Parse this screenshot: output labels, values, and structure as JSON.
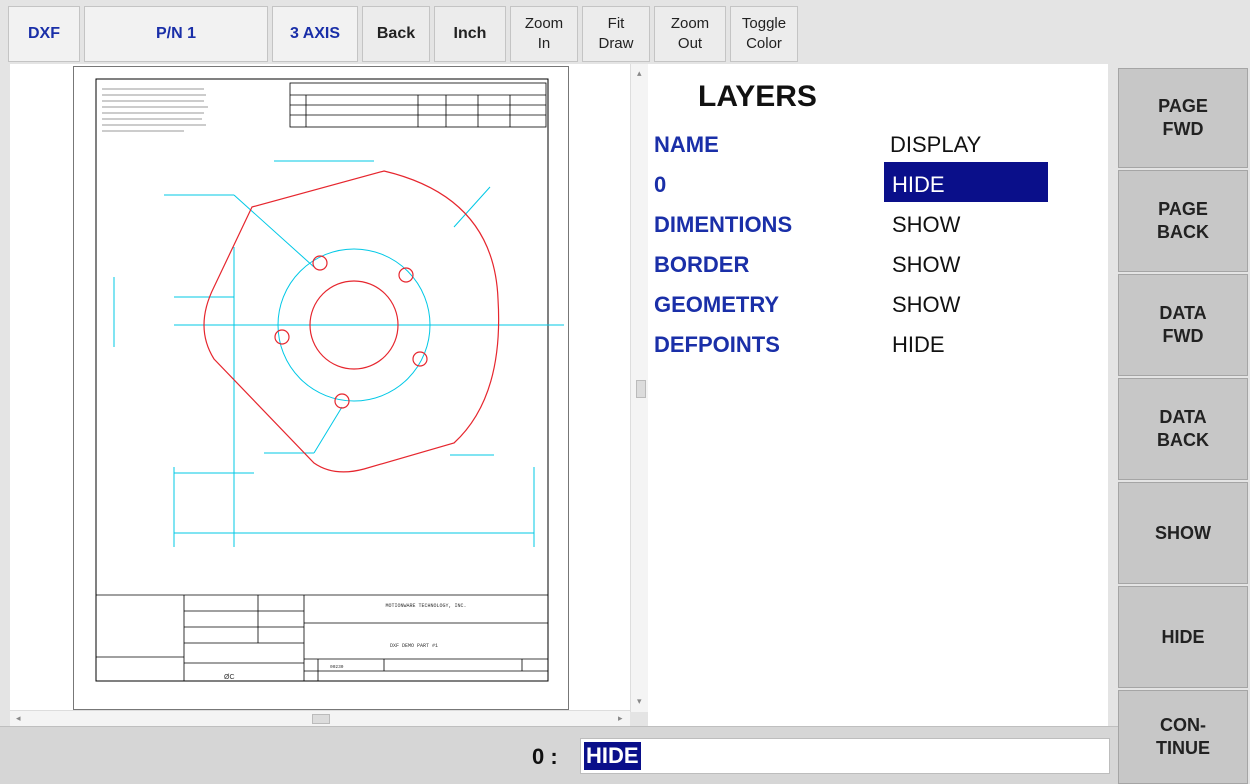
{
  "toolbar": {
    "dxf": "DXF",
    "pn": "P/N 1",
    "axis": "3 AXIS",
    "back": "Back",
    "inch": "Inch",
    "zoom_in": "Zoom\nIn",
    "fit_draw": "Fit\nDraw",
    "zoom_out": "Zoom\nOut",
    "toggle_color": "Toggle\nColor"
  },
  "layers": {
    "title": "LAYERS",
    "header_name": "NAME",
    "header_display": "DISPLAY",
    "rows": [
      {
        "name": "0",
        "display": "HIDE",
        "selected": true
      },
      {
        "name": "DIMENTIONS",
        "display": "SHOW"
      },
      {
        "name": "BORDER",
        "display": "SHOW"
      },
      {
        "name": "GEOMETRY",
        "display": "SHOW"
      },
      {
        "name": "DEFPOINTS",
        "display": "HIDE"
      }
    ]
  },
  "side_buttons": {
    "page_fwd": "PAGE\nFWD",
    "page_back": "PAGE\nBACK",
    "data_fwd": "DATA\nFWD",
    "data_back": "DATA\nBACK",
    "show": "SHOW",
    "hide": "HIDE",
    "continue": "CON-\nTINUE"
  },
  "status": {
    "prompt": "0 :",
    "value": "HIDE"
  },
  "drawing": {
    "title_text": "DXF DEMO PART #1",
    "company_text": "MOTIONWARE TECHNOLOGY, INC.",
    "part_number": "00230",
    "symbol_text": "ØC",
    "colors": {
      "border": "#000000",
      "dimensions": "#00c8e6",
      "geometry": "#e6262e",
      "selection": "#0a0f8a",
      "label_blue": "#1a2fa8"
    }
  }
}
